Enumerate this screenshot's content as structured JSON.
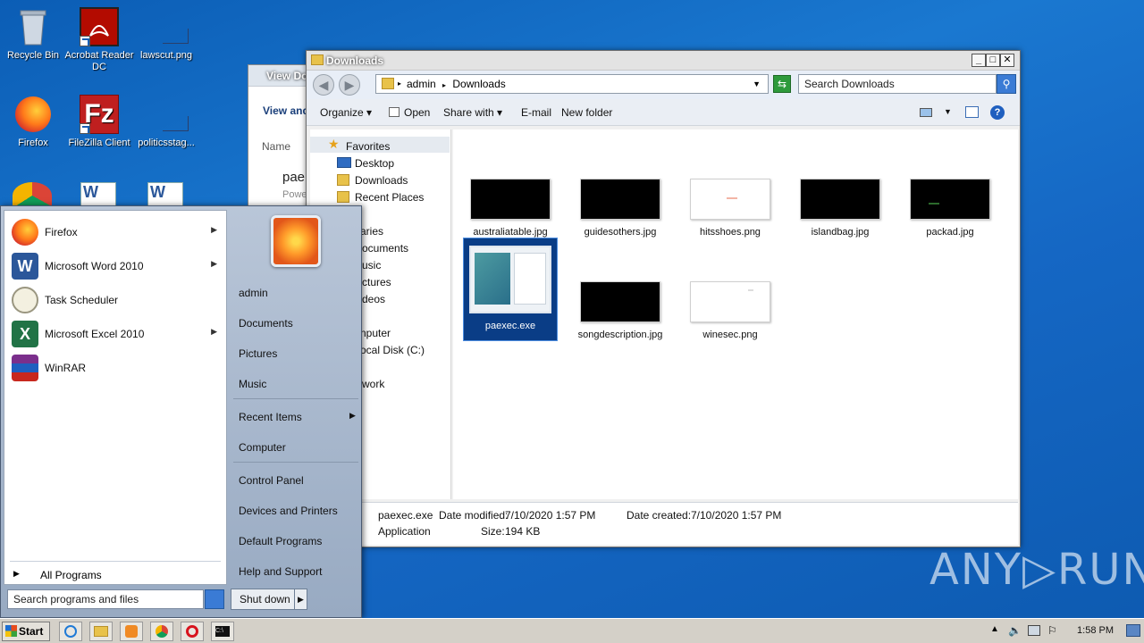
{
  "desktop": {
    "icons": [
      {
        "label": "Recycle Bin"
      },
      {
        "label": "Acrobat Reader DC"
      },
      {
        "label": "lawscut.png"
      },
      {
        "label": "Firefox"
      },
      {
        "label": "FileZilla Client"
      },
      {
        "label": "politicsstag..."
      }
    ]
  },
  "background_window": {
    "title": "View Do",
    "heading": "View and",
    "col_name": "Name",
    "file_partial": "pae",
    "sub_partial": "Powe"
  },
  "explorer": {
    "title": "Downloads",
    "address": {
      "segments": [
        "admin",
        "Downloads"
      ]
    },
    "search_placeholder": "Search Downloads",
    "toolbar": {
      "organize": "Organize",
      "open": "Open",
      "share_with": "Share with",
      "email": "E-mail",
      "new_folder": "New folder"
    },
    "nav": {
      "favorites": "Favorites",
      "desktop": "Desktop",
      "downloads": "Downloads",
      "recent_places": "Recent Places",
      "libraries": "aries",
      "documents": "ocuments",
      "music": "usic",
      "pictures": "ctures",
      "videos": "deos",
      "computer": "nputer",
      "local_disk": "ocal Disk (C:)",
      "network": "work"
    },
    "files": [
      {
        "name": "australiatable.jpg"
      },
      {
        "name": "guidesothers.jpg"
      },
      {
        "name": "hitsshoes.png"
      },
      {
        "name": "islandbag.jpg"
      },
      {
        "name": "packad.jpg"
      },
      {
        "name": "paexec.exe"
      },
      {
        "name": "songdescription.jpg"
      },
      {
        "name": "winesec.png"
      }
    ],
    "details": {
      "filename": "paexec.exe",
      "type": "Application",
      "date_modified_label": "Date modified:",
      "date_modified": "7/10/2020 1:57 PM",
      "date_created_label": "Date created:",
      "date_created": "7/10/2020 1:57 PM",
      "size_label": "Size:",
      "size": "194 KB"
    }
  },
  "start_menu": {
    "programs": [
      {
        "label": "Firefox"
      },
      {
        "label": "Microsoft Word 2010"
      },
      {
        "label": "Task Scheduler"
      },
      {
        "label": "Microsoft Excel 2010"
      },
      {
        "label": "WinRAR"
      }
    ],
    "all_programs": "All Programs",
    "search_placeholder": "Search programs and files",
    "right": {
      "user": "admin",
      "documents": "Documents",
      "pictures": "Pictures",
      "music": "Music",
      "recent_items": "Recent Items",
      "computer": "Computer",
      "control_panel": "Control Panel",
      "devices_printers": "Devices and Printers",
      "default_programs": "Default Programs",
      "help_support": "Help and Support"
    },
    "shutdown": "Shut down"
  },
  "taskbar": {
    "start": "Start",
    "clock": "1:58 PM"
  },
  "watermark": "ANY▷RUN"
}
